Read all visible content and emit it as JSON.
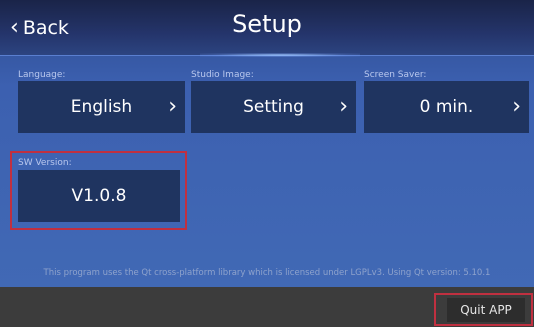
{
  "header": {
    "back_label": "Back",
    "title": "Setup"
  },
  "settings": {
    "language": {
      "label": "Language:",
      "value": "English"
    },
    "studio_image": {
      "label": "Studio Image:",
      "value": "Setting"
    },
    "screen_saver": {
      "label": "Screen Saver:",
      "value": "0 min."
    },
    "sw_version": {
      "label": "SW Version:",
      "value": "V1.0.8"
    }
  },
  "license_text": "This program uses the Qt cross-platform library which is licensed under LGPLv3. Using Qt version: 5.10.1",
  "footer": {
    "quit_label": "Quit APP"
  },
  "colors": {
    "tile_bg": "#1f3460",
    "highlight": "#c03040",
    "screen_bg": "#4169b5"
  }
}
